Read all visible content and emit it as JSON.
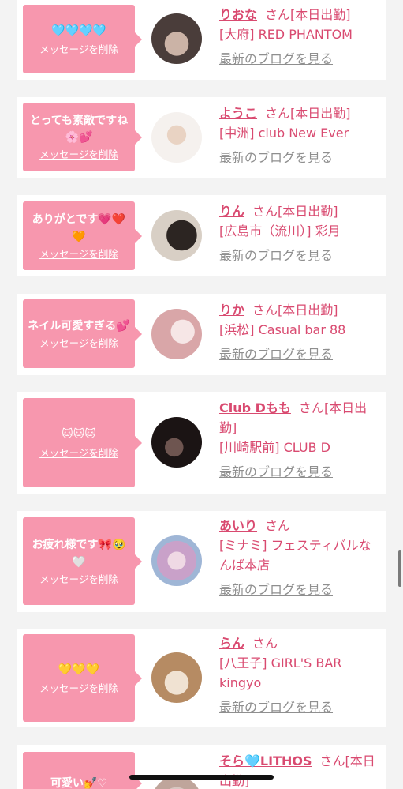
{
  "cards": [
    {
      "message": "🩵🩵🩵🩵",
      "delete_label": "メッセージを削除",
      "name": "りおな",
      "san": "さん[本日出勤]",
      "shop": "[大府] RED PHANTOM",
      "blog": "最新のブログを見る",
      "avatar_colors": [
        "#6a5a55",
        "#cbb3a6"
      ]
    },
    {
      "message": "とっても素敵ですね🌸💕",
      "delete_label": "メッセージを削除",
      "name": "ようこ",
      "san": "さん[本日出勤]",
      "shop": "[中洲] club New Ever",
      "blog": "最新のブログを見る",
      "avatar_colors": [
        "#f3eee9",
        "#e6d2c2"
      ]
    },
    {
      "message": "ありがとです💗❤️🧡",
      "delete_label": "メッセージを削除",
      "name": "りん",
      "san": "さん[本日出勤]",
      "shop": "[広島市（流川）] 彩月",
      "blog": "最新のブログを見る",
      "avatar_colors": [
        "#d8cfc5",
        "#2c2522"
      ]
    },
    {
      "message": "ネイル可愛すぎる💕",
      "delete_label": "メッセージを削除",
      "name": "りか",
      "san": "さん[本日出勤]",
      "shop": "[浜松] Casual bar 88",
      "blog": "最新のブログを見る",
      "avatar_colors": [
        "#e7b8b9",
        "#f3dadb"
      ]
    },
    {
      "message": "🐱🐱🐱",
      "delete_label": "メッセージを削除",
      "name": "Club Dもも",
      "san": "さん[本日出勤]",
      "shop": "[川崎駅前] CLUB D",
      "blog": "最新のブログを見る",
      "avatar_colors": [
        "#1b1414",
        "#6e5550"
      ]
    },
    {
      "message": "お疲れ様です🎀🥹🤍",
      "delete_label": "メッセージを削除",
      "name": "あいり",
      "san": "さん",
      "shop": "[ミナミ] フェスティバルなんば本店",
      "blog": "最新のブログを見る",
      "avatar_colors": [
        "#d9a0c0",
        "#9fb6d6"
      ]
    },
    {
      "message": "💛💛💛",
      "delete_label": "メッセージを削除",
      "name": "らん",
      "san": "さん",
      "shop": "[八王子] GIRL'S BAR kingyo",
      "blog": "最新のブログを見る",
      "avatar_colors": [
        "#c9a27a",
        "#efe0cf"
      ]
    },
    {
      "message": "可愛い💅♡",
      "delete_label": "",
      "name": "そら🩵LITHOS",
      "san": "さん[本日出勤]",
      "shop": "",
      "blog": "",
      "avatar_colors": [
        "#d7c6c0",
        "#bfa59b"
      ]
    }
  ]
}
